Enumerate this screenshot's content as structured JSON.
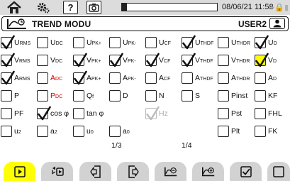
{
  "status_bar": {
    "icons": [
      "home-icon",
      "settings-icon",
      "help-icon",
      "camera-icon"
    ],
    "help_glyph": "?",
    "progress": 0.05,
    "datetime": "08/06/21 11:58",
    "faint_text": "↪🔒▮"
  },
  "header": {
    "title": "TREND MODU",
    "user": "USER2",
    "icons": [
      "trend-mode-icon",
      "user-icon"
    ]
  },
  "grid": {
    "rows": [
      [
        {
          "label": "URMS",
          "checked": true
        },
        {
          "label": "UDC",
          "checked": false
        },
        {
          "label": "UPK+",
          "checked": false
        },
        {
          "label": "UPK-",
          "checked": false
        },
        {
          "label": "UCF",
          "checked": false
        },
        {
          "label": "UTHDF",
          "checked": true
        },
        {
          "label": "UTHDR",
          "checked": false
        },
        {
          "label": "UD",
          "checked": true
        }
      ],
      [
        {
          "label": "VRMS",
          "checked": true
        },
        {
          "label": "VDC",
          "checked": false
        },
        {
          "label": "VPK+",
          "checked": true
        },
        {
          "label": "VPK-",
          "checked": true
        },
        {
          "label": "VCF",
          "checked": true
        },
        {
          "label": "VTHDF",
          "checked": true
        },
        {
          "label": "VTHDR",
          "checked": false
        },
        {
          "label": "VD",
          "checked": true,
          "highlighted": true
        }
      ],
      [
        {
          "label": "ARMS",
          "checked": true
        },
        {
          "label": "ADC",
          "checked": false,
          "color": "red"
        },
        {
          "label": "APK+",
          "checked": true
        },
        {
          "label": "APK-",
          "checked": false
        },
        {
          "label": "ACF",
          "checked": false
        },
        {
          "label": "ATHDF",
          "checked": false
        },
        {
          "label": "ATHDR",
          "checked": false
        },
        {
          "label": "AD",
          "checked": false
        }
      ],
      [
        {
          "label": "P",
          "checked": false
        },
        {
          "label": "PDC",
          "checked": false,
          "color": "red"
        },
        {
          "label": "Qf",
          "checked": false
        },
        {
          "label": "D",
          "checked": false
        },
        {
          "label": "N",
          "checked": false
        },
        {
          "label": "S",
          "checked": false
        },
        {
          "label": "Pinst",
          "checked": false
        },
        {
          "label": "KF",
          "checked": false
        }
      ],
      [
        {
          "label": "PF",
          "checked": false
        },
        {
          "label": "cos φ",
          "checked": true
        },
        {
          "label": "tan φ",
          "checked": false
        },
        null,
        {
          "label": "Hz",
          "checked": true,
          "disabled": true
        },
        null,
        {
          "label": "Pst",
          "checked": false
        },
        {
          "label": "FHL",
          "checked": false
        }
      ],
      [
        {
          "label": "u2",
          "checked": false
        },
        {
          "label": "a2",
          "checked": false
        },
        {
          "label": "u0",
          "checked": false
        },
        {
          "label": "a0",
          "checked": false
        },
        null,
        null,
        {
          "label": "Plt",
          "checked": false
        },
        {
          "label": "FK",
          "checked": false
        }
      ]
    ],
    "page_left": "1/3",
    "page_right": "1/4"
  },
  "softkeys": [
    {
      "icon": "play-icon",
      "active": true
    },
    {
      "icon": "channel-select-icon",
      "active": false
    },
    {
      "icon": "page-previous-icon",
      "active": false
    },
    {
      "icon": "page-next-icon",
      "active": false
    },
    {
      "icon": "trend-minus-icon",
      "active": false
    },
    {
      "icon": "trend-plus-icon",
      "active": false
    },
    {
      "icon": "check-all-icon",
      "active": false
    },
    {
      "icon": "uncheck-all-icon",
      "active": false
    }
  ]
}
